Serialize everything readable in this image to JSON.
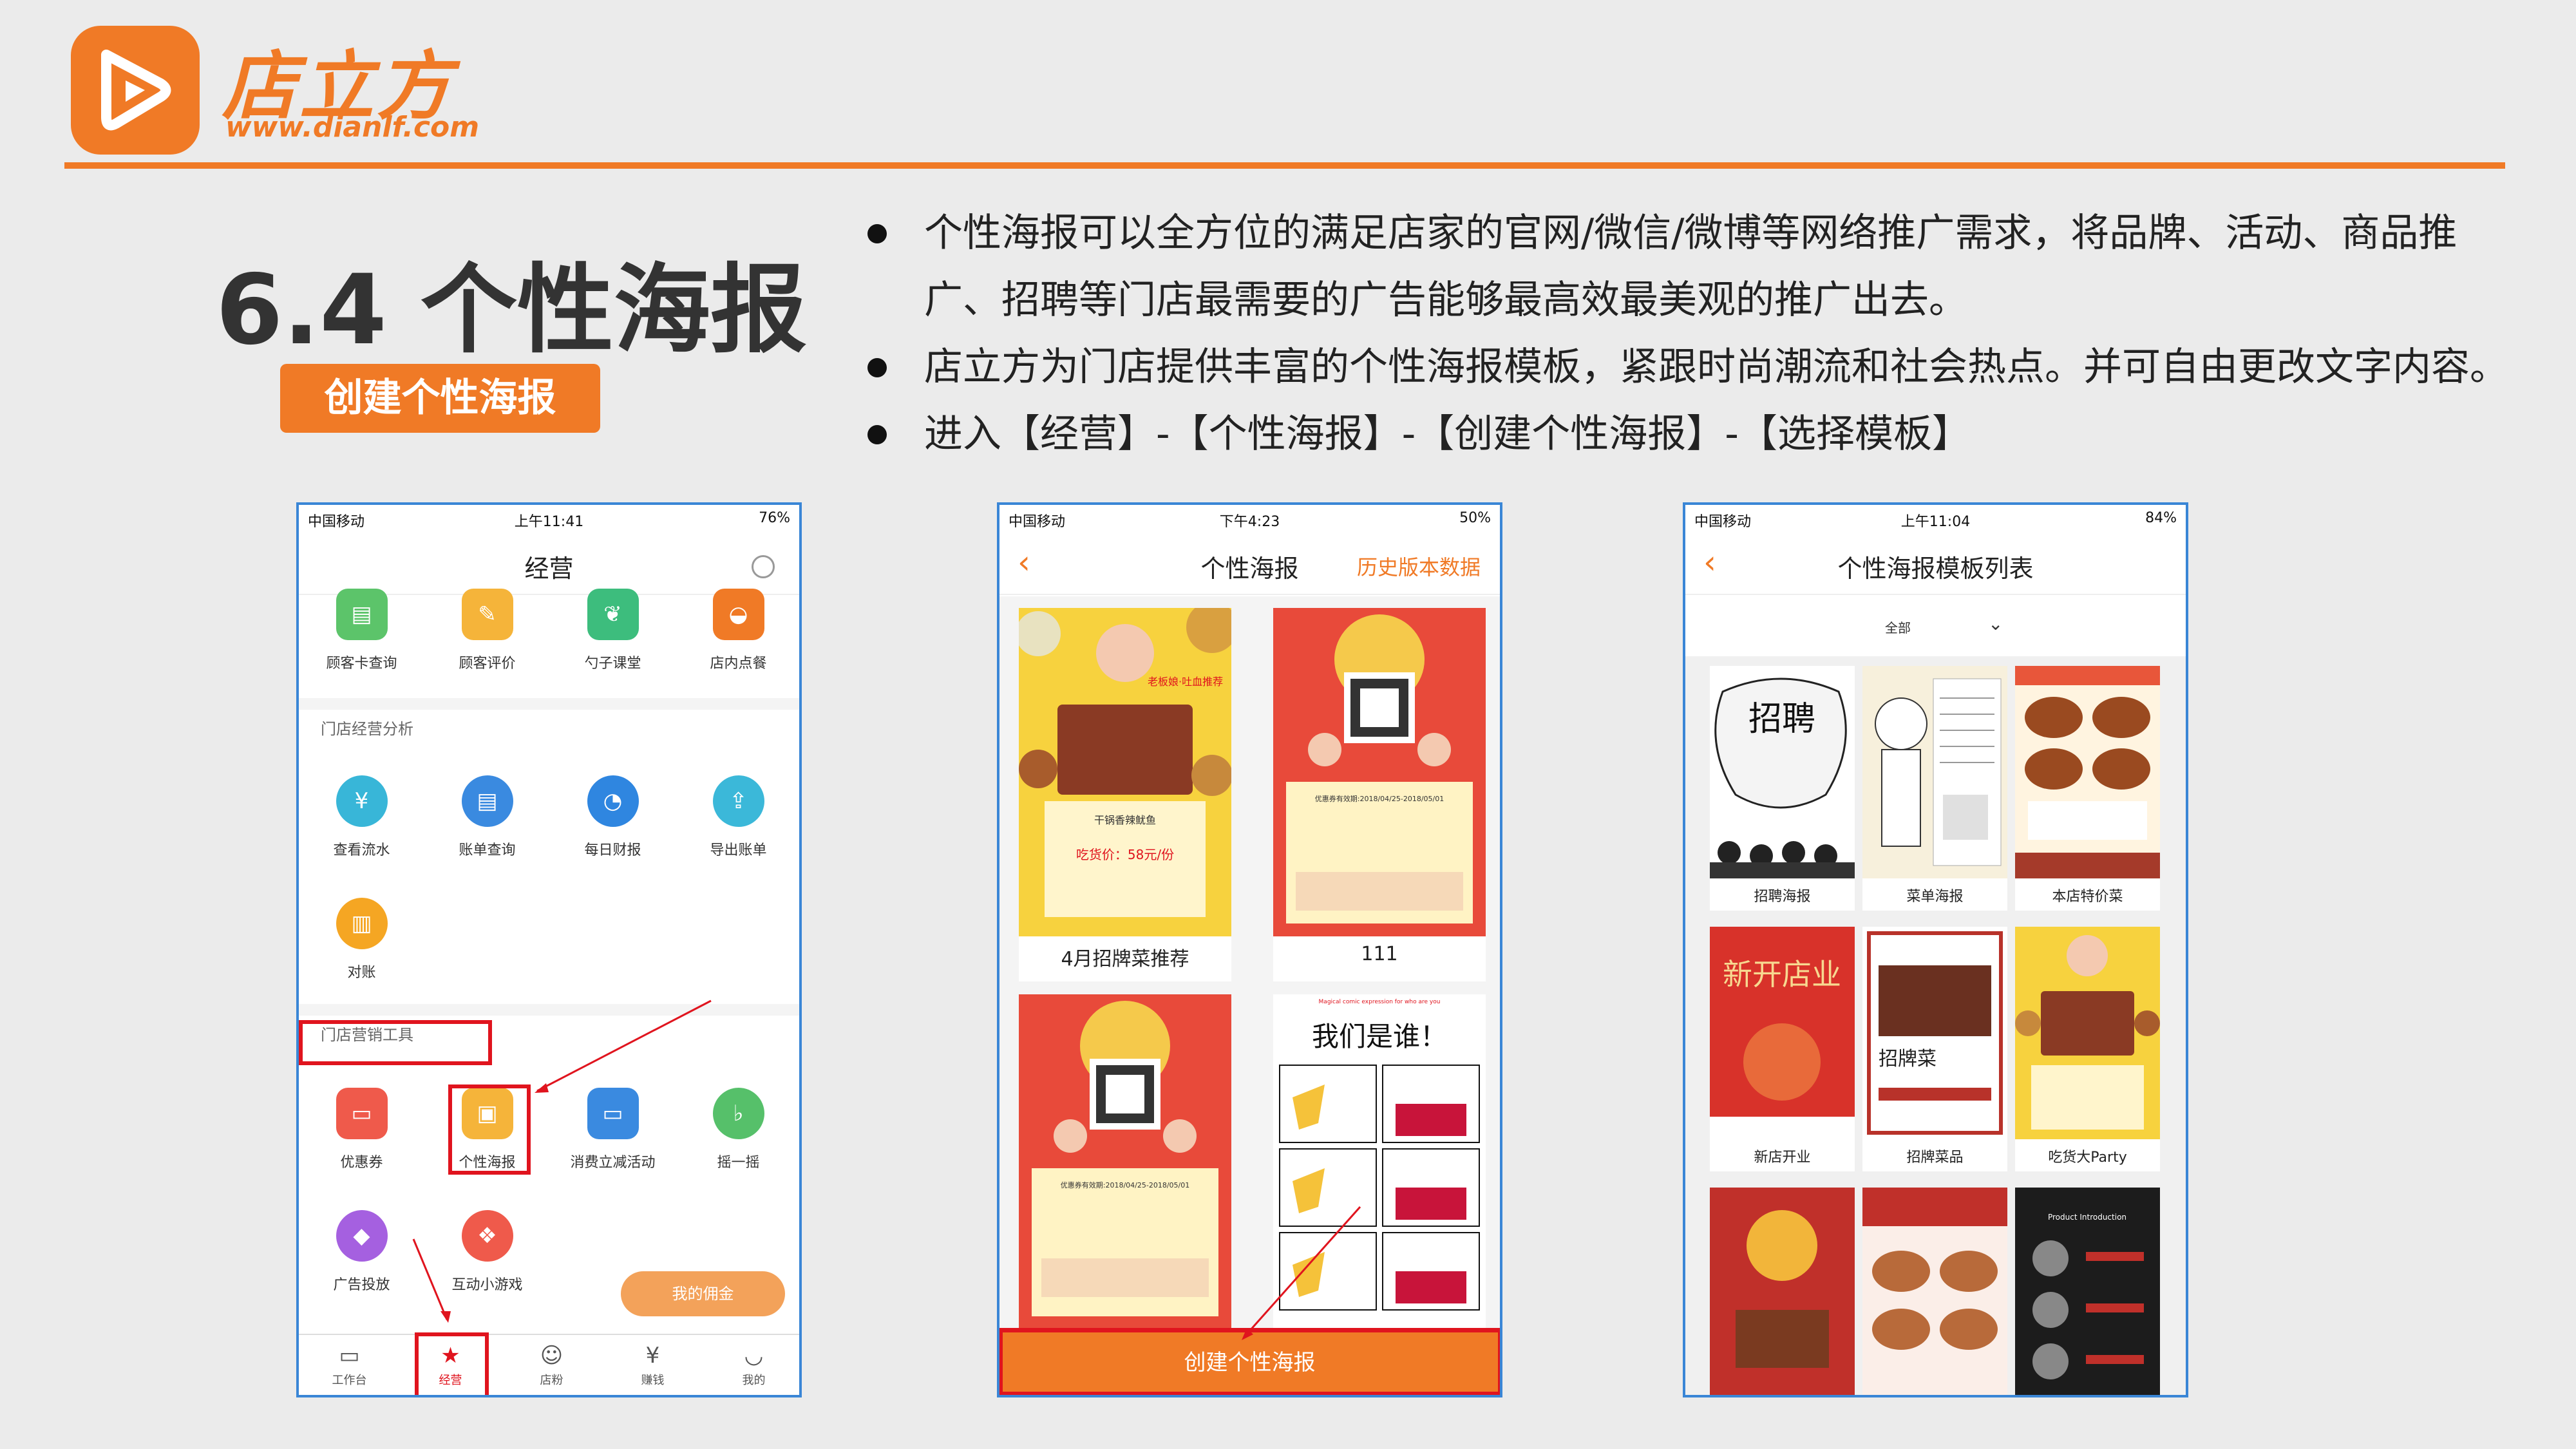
{
  "brand": {
    "name": "店立方",
    "url": "www.dianlf.com"
  },
  "title": "6.4 个性海报",
  "badge": "创建个性海报",
  "bullets": [
    "个性海报可以全方位的满足店家的官网/微信/微博等网络推广需求，将品牌、活动、商品推广、招聘等门店最需要的广告能够最高效最美观的推广出去。",
    "店立方为门店提供丰富的个性海报模板，紧跟时尚潮流和社会热点。并可自由更改文字内容。",
    "进入【经营】-【个性海报】-【创建个性海报】-【选择模板】"
  ],
  "phone1": {
    "status": {
      "carrier": "中国移动",
      "time": "上午11:41",
      "battery": "76%"
    },
    "title": "经营",
    "top_items": [
      "顾客卡查询",
      "顾客评价",
      "勺子课堂",
      "店内点餐"
    ],
    "section1": "门店经营分析",
    "analysis_items": [
      "查看流水",
      "账单查询",
      "每日财报",
      "导出账单",
      "对账"
    ],
    "section2": "门店营销工具",
    "marketing_items": [
      "优惠券",
      "个性海报",
      "消费立减活动",
      "摇一摇",
      "广告投放",
      "互动小游戏"
    ],
    "commission_btn": "我的佣金",
    "tabs": [
      "工作台",
      "经营",
      "店粉",
      "赚钱",
      "我的"
    ]
  },
  "phone2": {
    "status": {
      "carrier": "中国移动",
      "time": "下午4:23",
      "battery": "50%"
    },
    "title": "个性海报",
    "history": "历史版本数据",
    "cards": [
      "4月招牌菜推荐",
      "111"
    ],
    "poster_texts": {
      "a_tag": "老板娘·吐血推荐",
      "a_dish": "干锅香辣鱿鱼",
      "a_price": "吃货价：58元/份",
      "b_date": "优惠券有效期:2018/04/25-2018/05/01",
      "c_title": "我们是谁！",
      "c_eng": "Magical comic expression for who are you"
    },
    "create_button": "创建个性海报"
  },
  "phone3": {
    "status": {
      "carrier": "中国移动",
      "time": "上午11:04",
      "battery": "84%"
    },
    "title": "个性海报模板列表",
    "filter": "全部",
    "templates": [
      "招聘海报",
      "菜单海报",
      "本店特价菜",
      "新店开业",
      "招牌菜品",
      "吃货大Party"
    ],
    "t_texts": {
      "recruit": "招聘",
      "newshop": "新开店业",
      "signature": "招牌菜",
      "intro": "Product Introduction"
    }
  }
}
